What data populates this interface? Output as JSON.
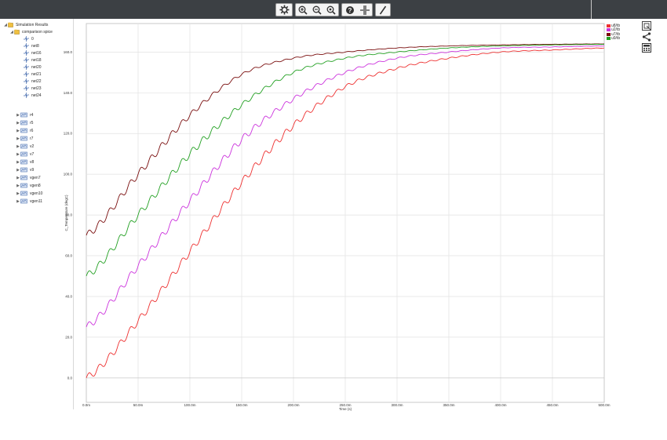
{
  "toolbar": {
    "icons": [
      "settings-icon",
      "zoom-in-icon",
      "zoom-out-icon",
      "zoom-fit-icon",
      "help-icon",
      "crosshair-icon",
      "pen-icon"
    ]
  },
  "tree": {
    "root": "Simulation Results",
    "child": "comparison spice",
    "nets": [
      "0",
      "net8",
      "net16",
      "net18",
      "net20",
      "net21",
      "net22",
      "net23",
      "net24"
    ],
    "parts": [
      "r4",
      "r5",
      "r6",
      "r7",
      "v2",
      "v7",
      "v8",
      "v9",
      "vgen7",
      "vgen8",
      "vgen10",
      "vgen11"
    ]
  },
  "chart_data": {
    "type": "line",
    "xlabel": "Time (s)",
    "ylabel": "C_Temperature (degC)",
    "xlim": [
      0,
      500
    ],
    "ylim": [
      -12,
      174
    ],
    "x_ticks": [
      "0.0m",
      "50.0m",
      "100.0m",
      "150.0m",
      "200.0m",
      "250.0m",
      "300.0m",
      "350.0m",
      "400.0m",
      "450.0m",
      "500.0m"
    ],
    "y_ticks": [
      "0.0",
      "20.0",
      "40.0",
      "60.0",
      "80.0",
      "100.0",
      "120.0",
      "140.0",
      "160.0"
    ],
    "grid": true,
    "legend_position": "top-right",
    "x_ms": [
      0,
      50,
      100,
      150,
      200,
      250,
      300,
      350,
      400,
      450,
      500
    ],
    "series": [
      {
        "name": "u8/tb",
        "color": "#ee3030",
        "values": [
          0,
          28,
          62,
          96,
          124,
          143,
          152,
          157,
          160,
          161,
          162
        ]
      },
      {
        "name": "u2/tb",
        "color": "#cc33dd",
        "values": [
          25,
          55,
          87,
          117,
          137,
          150,
          157,
          160,
          162,
          162.5,
          163
        ]
      },
      {
        "name": "u7/tb",
        "color": "#7a0e0e",
        "values": [
          70,
          100,
          129,
          149,
          157,
          160,
          162,
          163,
          163.5,
          163.8,
          164
        ]
      },
      {
        "name": "u9/tb",
        "color": "#22a022",
        "values": [
          50,
          80,
          110,
          134,
          150,
          157,
          160,
          162,
          163,
          163.5,
          163.8
        ]
      }
    ]
  }
}
